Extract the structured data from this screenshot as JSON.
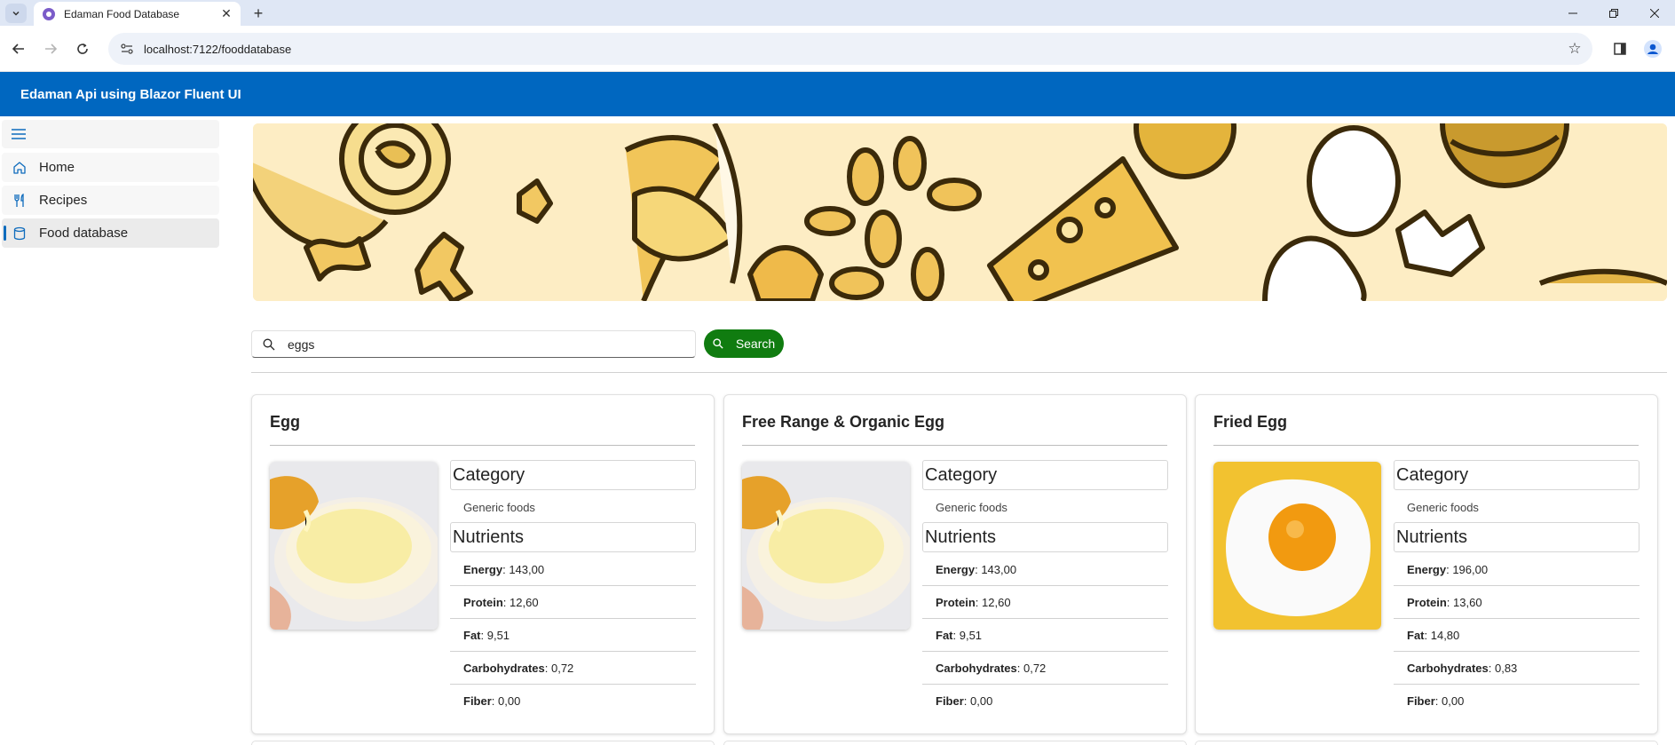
{
  "browser": {
    "tab_title": "Edaman Food Database",
    "url": "localhost:7122/fooddatabase"
  },
  "app": {
    "title": "Edaman Api using Blazor Fluent UI"
  },
  "sidebar": {
    "items": [
      {
        "label": "Home",
        "icon": "home-icon"
      },
      {
        "label": "Recipes",
        "icon": "utensils-icon"
      },
      {
        "label": "Food database",
        "icon": "database-icon",
        "active": true
      }
    ]
  },
  "search": {
    "value": "eggs",
    "button_label": "Search"
  },
  "labels": {
    "category": "Category",
    "nutrients": "Nutrients",
    "energy": "Energy",
    "protein": "Protein",
    "fat": "Fat",
    "carbohydrates": "Carbohydrates",
    "fiber": "Fiber"
  },
  "foods": [
    {
      "name": "Egg",
      "category": "Generic foods",
      "image": "raw-egg-in-bowl",
      "energy": "143,00",
      "protein": "12,60",
      "fat": "9,51",
      "carbohydrates": "0,72",
      "fiber": "0,00"
    },
    {
      "name": "Free Range & Organic Egg",
      "category": "Generic foods",
      "image": "raw-egg-in-bowl",
      "energy": "143,00",
      "protein": "12,60",
      "fat": "9,51",
      "carbohydrates": "0,72",
      "fiber": "0,00"
    },
    {
      "name": "Fried Egg",
      "category": "Generic foods",
      "image": "fried-egg",
      "energy": "196,00",
      "protein": "13,60",
      "fat": "14,80",
      "carbohydrates": "0,83",
      "fiber": "0,00"
    }
  ],
  "colors": {
    "header": "#0067c0",
    "search_button": "#107c10",
    "accent": "#0f6cbd",
    "banner": "#fdedc4"
  }
}
